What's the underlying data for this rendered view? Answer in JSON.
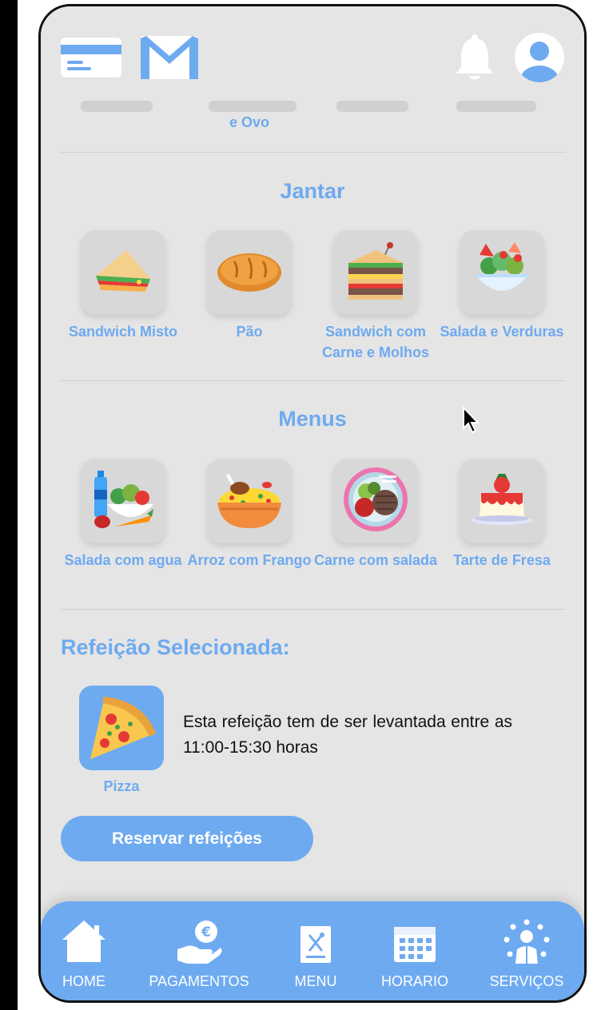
{
  "topbar": {
    "icons": [
      "credit-card-icon",
      "mail-icon",
      "bell-icon",
      "user-avatar-icon"
    ]
  },
  "previous_section": {
    "visible_label_fragment": "e Ovo"
  },
  "sections": [
    {
      "title": "Jantar",
      "items": [
        {
          "label": "Sandwich Misto",
          "icon": "sandwich-icon"
        },
        {
          "label": "Pão",
          "icon": "bread-icon"
        },
        {
          "label": "Sandwich com Carne e Molhos",
          "icon": "club-sandwich-icon"
        },
        {
          "label": "Salada e Verduras",
          "icon": "salad-icon"
        }
      ]
    },
    {
      "title": "Menus",
      "items": [
        {
          "label": "Salada com agua",
          "icon": "salad-water-icon"
        },
        {
          "label": "Arroz com Frango",
          "icon": "rice-chicken-icon"
        },
        {
          "label": "Carne com salada",
          "icon": "meat-plate-icon"
        },
        {
          "label": "Tarte de Fresa",
          "icon": "strawberry-pudding-icon"
        }
      ]
    }
  ],
  "selected": {
    "heading": "Refeição Selecionada:",
    "name": "Pizza",
    "icon": "pizza-icon",
    "note": "Esta refeição tem de ser levantada entre as 11:00-15:30 horas"
  },
  "reserve_button": "Reservar refeições",
  "bottom_nav": [
    {
      "label": "HOME",
      "icon": "home-icon"
    },
    {
      "label": "PAGAMENTOS",
      "icon": "payment-hand-euro-icon"
    },
    {
      "label": "MENU",
      "icon": "menu-card-icon"
    },
    {
      "label": "HORARIO",
      "icon": "calendar-icon"
    },
    {
      "label": "SERVIÇOS",
      "icon": "services-person-icon"
    }
  ],
  "colors": {
    "accent": "#6eaaf0",
    "background": "#e5e5e5",
    "tile": "#d8d8d8"
  }
}
